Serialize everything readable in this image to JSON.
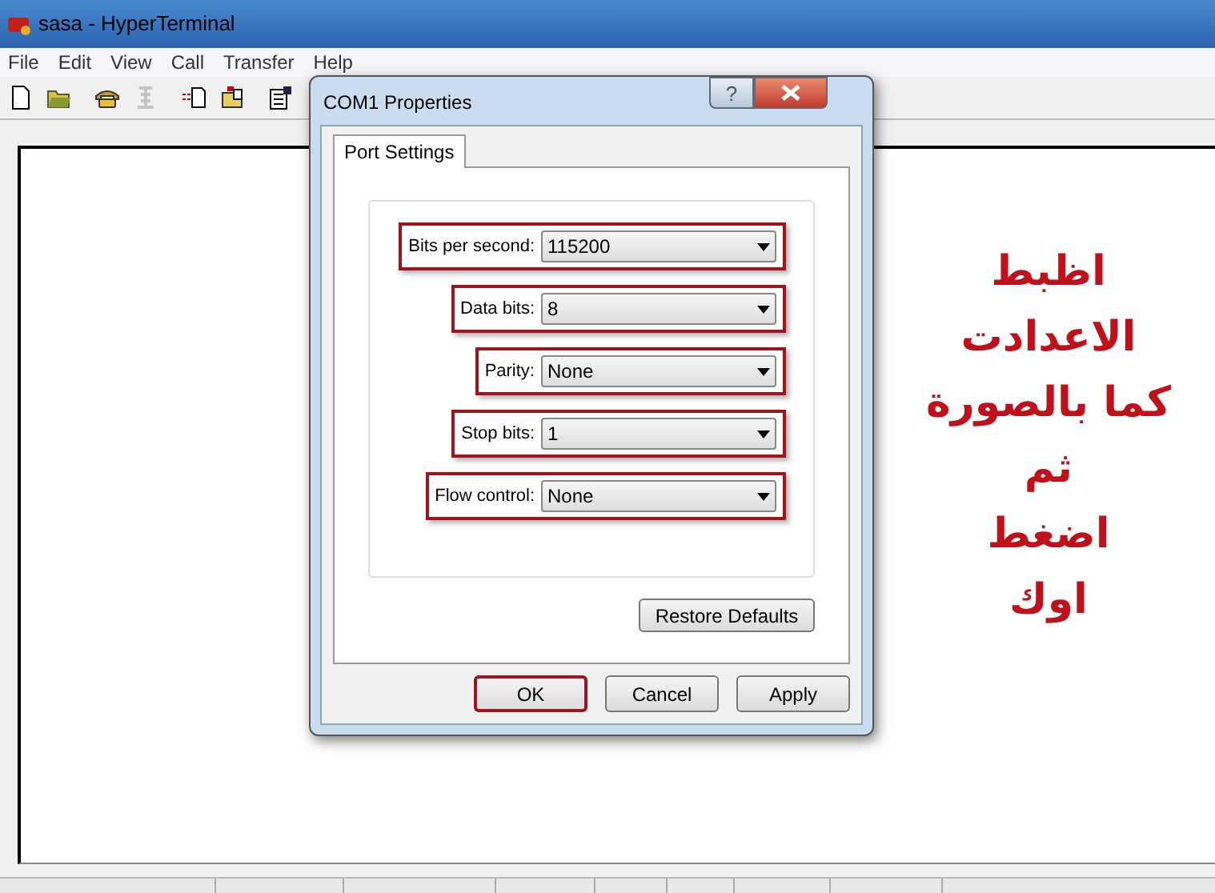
{
  "window": {
    "title": "sasa - HyperTerminal"
  },
  "menu": [
    "File",
    "Edit",
    "View",
    "Call",
    "Transfer",
    "Help"
  ],
  "toolbar": [
    {
      "kind": "new",
      "disabled": false
    },
    {
      "kind": "open",
      "disabled": false
    },
    {
      "kind": "phone",
      "disabled": false
    },
    {
      "kind": "hangup",
      "disabled": true
    },
    {
      "kind": "send",
      "disabled": false
    },
    {
      "kind": "receive",
      "disabled": false
    },
    {
      "kind": "properties",
      "disabled": false
    }
  ],
  "dialog": {
    "title": "COM1 Properties",
    "help": "?",
    "tabs": [
      {
        "label": "Port Settings",
        "selected": true
      }
    ],
    "fields": [
      {
        "label": "Bits per second:",
        "value": "115200",
        "highlighted": true
      },
      {
        "label": "Data bits:",
        "value": "8",
        "highlighted": true
      },
      {
        "label": "Parity:",
        "value": "None",
        "highlighted": true
      },
      {
        "label": "Stop bits:",
        "value": "1",
        "highlighted": true
      },
      {
        "label": "Flow control:",
        "value": "None",
        "highlighted": true
      }
    ],
    "restore_button": "Restore Defaults",
    "buttons": [
      {
        "label": "OK",
        "highlighted": true
      },
      {
        "label": "Cancel",
        "highlighted": false
      },
      {
        "label": "Apply",
        "highlighted": false
      }
    ]
  },
  "annotation": {
    "lines": [
      "اظبط الاعدادت",
      "كما بالصورة",
      "ثم",
      "اضغط",
      "اوك"
    ]
  }
}
